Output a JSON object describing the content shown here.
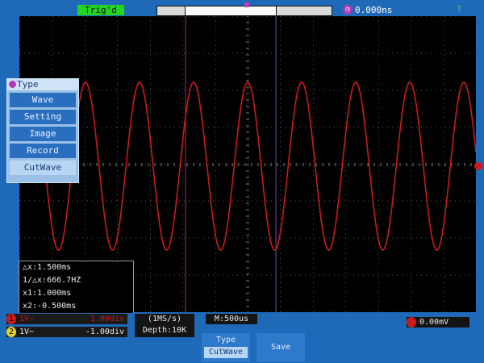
{
  "header": {
    "trigger_status_label": "Trig'd",
    "trigger_position": "0.000ns",
    "status_mark": "T"
  },
  "type_menu": {
    "title": "Type",
    "items": [
      {
        "label": "Wave",
        "selected": false
      },
      {
        "label": "Setting",
        "selected": false
      },
      {
        "label": "Image",
        "selected": false
      },
      {
        "label": "Record",
        "selected": false
      },
      {
        "label": "CutWave",
        "selected": true
      }
    ]
  },
  "measurements": [
    "△x:1.500ms",
    "1/△x:666.7HZ",
    "x1:1.000ms",
    "x2:-0.500ms"
  ],
  "channels": {
    "ch1": {
      "coupling": "1V~",
      "scale": "1.00div"
    },
    "ch2": {
      "coupling": "1V~",
      "scale": "-1.00div"
    }
  },
  "acquisition": {
    "sample_rate": "(1MS/s)",
    "depth": "Depth:10K",
    "timebase": "M:500us",
    "trigger_level": "0.00mV"
  },
  "softkeys": {
    "type_label": "Type",
    "type_value": "CutWave",
    "save_label": "Save"
  },
  "colors": {
    "background": "#1f69b9",
    "ch1": "#cc1a1a",
    "trigger_badge": "#22d522"
  }
}
